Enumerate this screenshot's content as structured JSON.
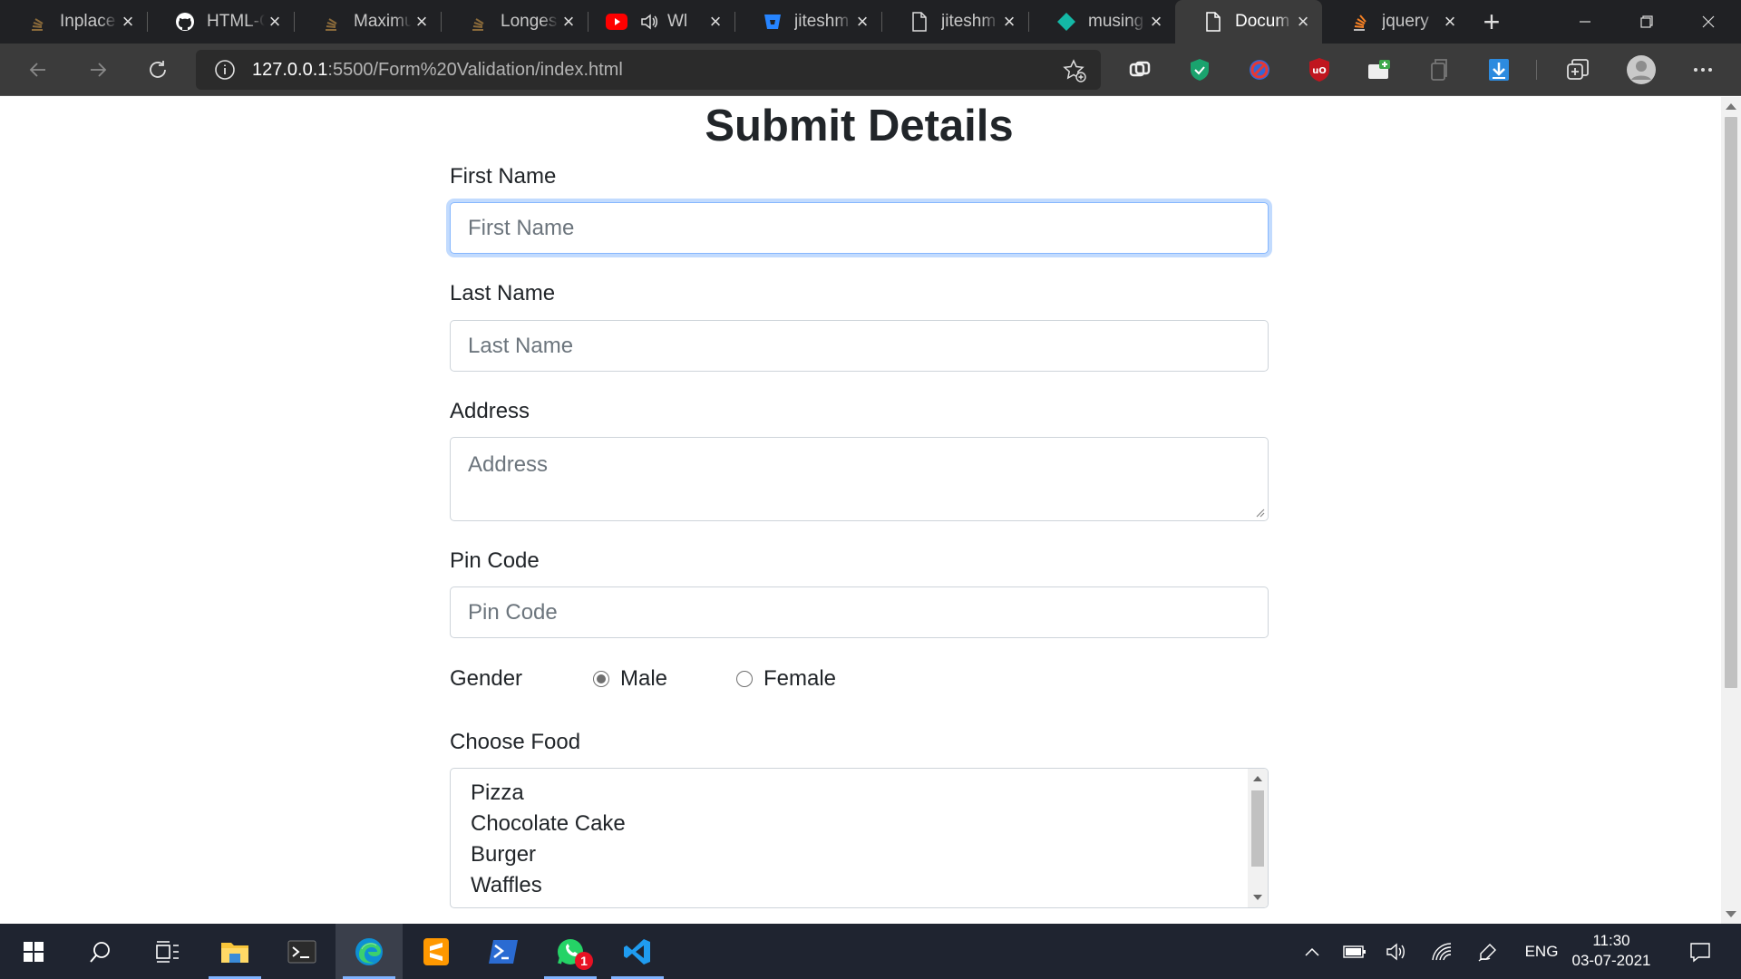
{
  "browser": {
    "tabs": [
      {
        "title": "Inplace",
        "icon": "stackoverflow-icon",
        "active": false
      },
      {
        "title": "HTML-C",
        "icon": "github-icon",
        "active": false
      },
      {
        "title": "Maximu",
        "icon": "stackoverflow-icon",
        "active": false
      },
      {
        "title": "Longes",
        "icon": "stackoverflow-icon",
        "active": false
      },
      {
        "title": "Wl",
        "icon": "youtube-icon",
        "active": false
      },
      {
        "title": "jiteshm",
        "icon": "bitbucket-icon",
        "active": false
      },
      {
        "title": "jiteshm",
        "icon": "document-icon",
        "active": false
      },
      {
        "title": "musing",
        "icon": "diamond-icon",
        "active": false
      },
      {
        "title": "Docum",
        "icon": "document-icon",
        "active": true
      },
      {
        "title": "jquery",
        "icon": "stackoverflow-icon",
        "active": false
      }
    ],
    "address_bar": {
      "host": "127.0.0.1",
      "path": ":5500/Form%20Validation/index.html"
    }
  },
  "page": {
    "title": "Submit Details",
    "first_name": {
      "label": "First Name",
      "placeholder": "First Name",
      "value": ""
    },
    "last_name": {
      "label": "Last Name",
      "placeholder": "Last Name",
      "value": ""
    },
    "address": {
      "label": "Address",
      "placeholder": "Address",
      "value": ""
    },
    "pin_code": {
      "label": "Pin Code",
      "placeholder": "Pin Code",
      "value": ""
    },
    "gender": {
      "label": "Gender",
      "options": [
        {
          "label": "Male",
          "checked": true
        },
        {
          "label": "Female",
          "checked": false
        }
      ]
    },
    "food": {
      "label": "Choose Food",
      "options": [
        "Pizza",
        "Chocolate Cake",
        "Burger",
        "Waffles"
      ]
    }
  },
  "taskbar": {
    "apps": [
      "windows-start-icon",
      "search-icon",
      "task-view-icon",
      "file-explorer-icon",
      "terminal-icon",
      "edge-icon",
      "sublime-text-icon",
      "powershell-icon",
      "whatsapp-icon",
      "vscode-icon"
    ],
    "whatsapp_badge": "1",
    "language": "ENG",
    "time": "11:30",
    "date": "03-07-2021"
  }
}
